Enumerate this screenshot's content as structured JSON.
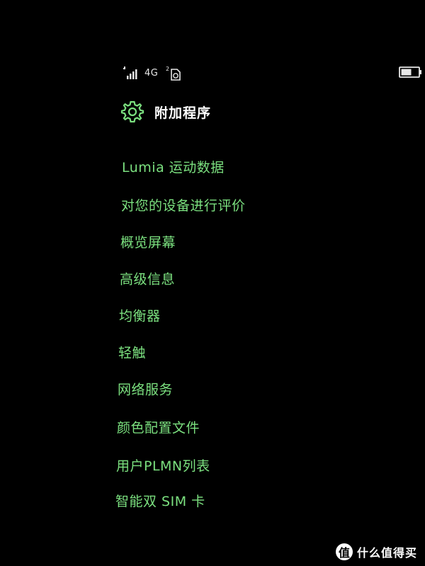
{
  "status_bar": {
    "signal_icon": "signal-bars-icon",
    "network_type": "4G",
    "sim2_icon": "sim2-icon",
    "battery_icon": "battery-icon"
  },
  "header": {
    "icon": "gear-icon",
    "title": "附加程序"
  },
  "menu": {
    "items": [
      {
        "label": "Lumia 运动数据"
      },
      {
        "label": "对您的设备进行评价"
      },
      {
        "label": "概览屏幕"
      },
      {
        "label": "高级信息"
      },
      {
        "label": "均衡器"
      },
      {
        "label": "轻触"
      },
      {
        "label": "网络服务"
      },
      {
        "label": "颜色配置文件"
      },
      {
        "label": "用户PLMN列表"
      },
      {
        "label": "智能双 SIM 卡"
      }
    ]
  },
  "watermark": {
    "badge": "值",
    "text": "什么值得买"
  },
  "colors": {
    "accent": "#7be07f",
    "background": "#000000",
    "header_text": "#ffffff"
  }
}
